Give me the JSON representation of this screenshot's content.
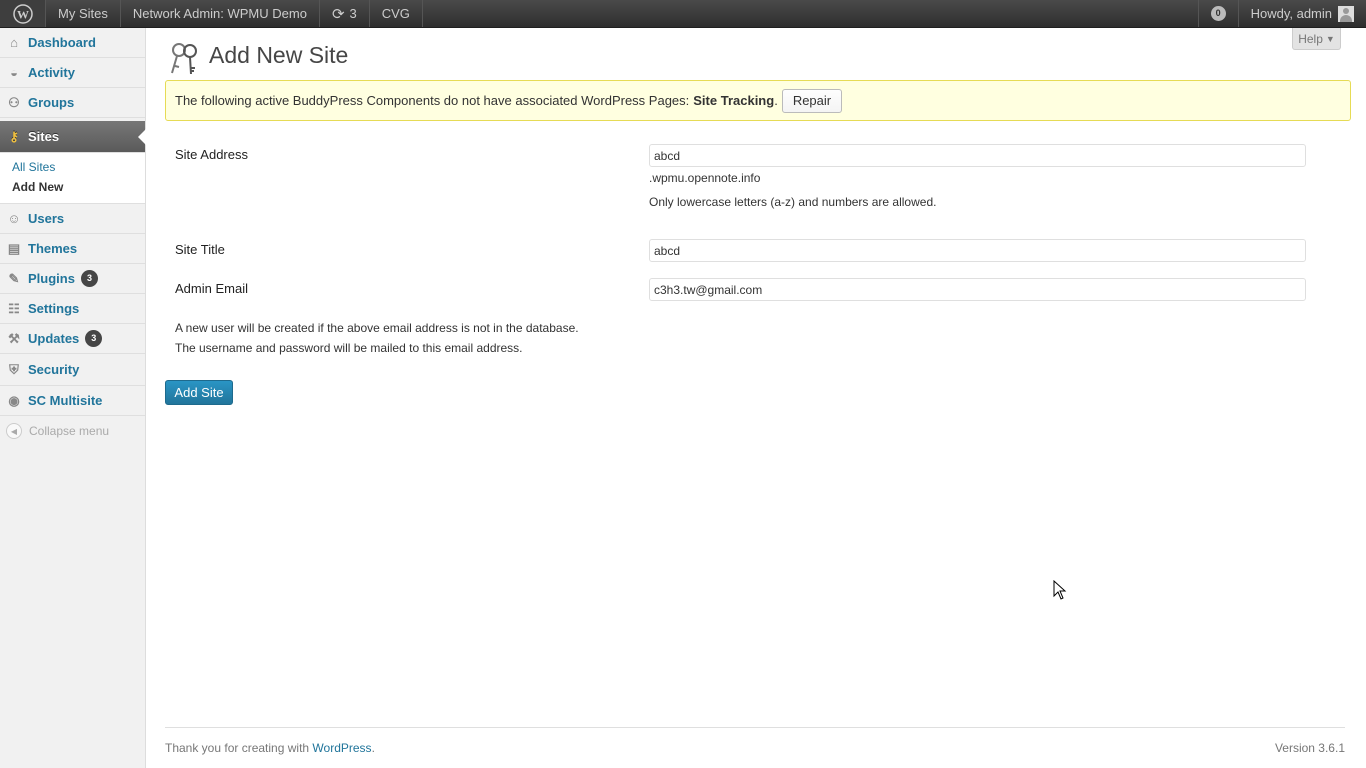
{
  "adminbar": {
    "wp_logo": "wordpress-icon",
    "my_sites": "My Sites",
    "network_admin": "Network Admin: WPMU Demo",
    "updates_count": "3",
    "site": "CVG",
    "notifications": "0",
    "howdy": "Howdy, admin"
  },
  "sidebar": {
    "items": [
      {
        "label": "Dashboard",
        "icon": "home-icon"
      },
      {
        "label": "Activity",
        "icon": "activity-icon"
      },
      {
        "label": "Groups",
        "icon": "groups-icon"
      },
      {
        "label": "Sites",
        "icon": "sites-icon"
      },
      {
        "label": "Users",
        "icon": "users-icon"
      },
      {
        "label": "Themes",
        "icon": "themes-icon"
      },
      {
        "label": "Plugins",
        "icon": "plugins-icon",
        "count": "3"
      },
      {
        "label": "Settings",
        "icon": "settings-icon"
      },
      {
        "label": "Updates",
        "icon": "updates-icon",
        "count": "3"
      },
      {
        "label": "Security",
        "icon": "security-icon"
      },
      {
        "label": "SC Multisite",
        "icon": "multisite-icon"
      }
    ],
    "submenu": [
      "All Sites",
      "Add New"
    ],
    "collapse": "Collapse menu"
  },
  "main": {
    "help": "Help",
    "title": "Add New Site",
    "notice_text": "The following active BuddyPress Components do not have associated WordPress Pages:",
    "notice_bold": "Site Tracking",
    "notice_period": ".",
    "repair": "Repair",
    "form": {
      "site_address_label": "Site Address",
      "site_address_value": "abcd",
      "site_address_suffix": ".wpmu.opennote.info",
      "site_address_hint": "Only lowercase letters (a-z) and numbers are allowed.",
      "site_title_label": "Site Title",
      "site_title_value": "abcd",
      "admin_email_label": "Admin Email",
      "admin_email_value": "c3h3.tw@gmail.com",
      "info_line1": "A new user will be created if the above email address is not in the database.",
      "info_line2": "The username and password will be mailed to this email address.",
      "submit": "Add Site"
    }
  },
  "footer": {
    "thanks": "Thank you for creating with",
    "link": "WordPress",
    "period": ".",
    "version": "Version 3.6.1"
  }
}
